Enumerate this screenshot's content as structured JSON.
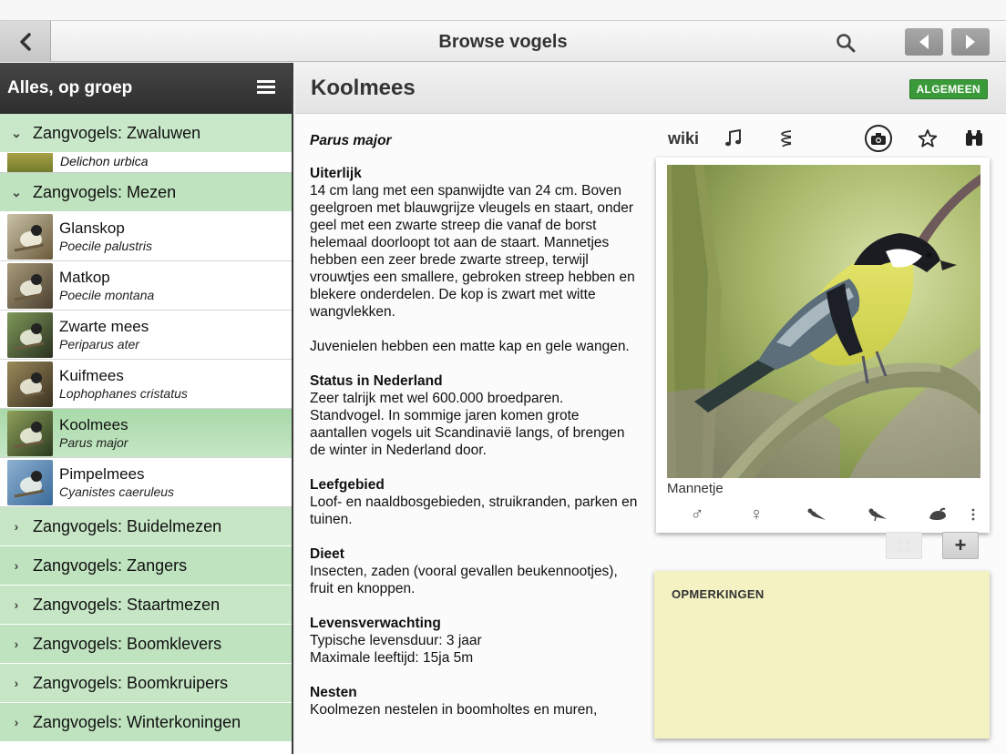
{
  "topbar": {
    "title": "Browse vogels",
    "icons": [
      "back-arrow-icon",
      "search-icon",
      "previous-arrow-icon",
      "next-arrow-icon"
    ]
  },
  "sidebar": {
    "title": "Alles, op groep",
    "groups_top": [
      {
        "label": "Zangvogels: Zwaluwen",
        "partial_item": {
          "scientific": "Delichon urbica"
        }
      },
      {
        "label": "Zangvogels: Mezen"
      }
    ],
    "birds": [
      {
        "name": "Glanskop",
        "scientific": "Poecile palustris"
      },
      {
        "name": "Matkop",
        "scientific": "Poecile montana"
      },
      {
        "name": "Zwarte mees",
        "scientific": "Periparus ater"
      },
      {
        "name": "Kuifmees",
        "scientific": "Lophophanes cristatus"
      },
      {
        "name": "Koolmees",
        "scientific": "Parus major",
        "selected": true
      },
      {
        "name": "Pimpelmees",
        "scientific": "Cyanistes caeruleus"
      }
    ],
    "groups": [
      {
        "label": "Zangvogels: Buidelmezen"
      },
      {
        "label": "Zangvogels: Zangers"
      },
      {
        "label": "Zangvogels: Staartmezen"
      },
      {
        "label": "Zangvogels: Boomklevers"
      },
      {
        "label": "Zangvogels: Boomkruipers"
      },
      {
        "label": "Zangvogels: Winterkoningen"
      }
    ]
  },
  "main": {
    "title": "Koolmees",
    "badge": "ALGEMEEN",
    "latin": "Parus major",
    "sections": [
      {
        "heading": "Uiterlijk",
        "text": "14 cm lang met een spanwijdte van 24 cm. Boven geelgroen met blauwgrijze vleugels en staart, onder geel met een zwarte streep die vanaf de borst helemaal doorloopt tot aan de staart. Mannetjes hebben een zeer brede zwarte streep, terwijl vrouwtjes een smallere, gebroken streep hebben en blekere onderdelen. De kop is zwart met witte wangvlekken."
      },
      {
        "heading": "",
        "text": "Juvenielen hebben een matte kap en gele wangen."
      },
      {
        "heading": "Status in Nederland",
        "text": "Zeer talrijk met wel 600.000 broedparen. Standvogel. In sommige jaren komen grote aantallen vogels uit Scandinavië langs, of brengen de winter in Nederland door."
      },
      {
        "heading": "Leefgebied",
        "text": "Loof- en naaldbosgebieden, struikranden, parken en tuinen."
      },
      {
        "heading": "Dieet",
        "text": "Insecten, zaden (vooral gevallen beukennootjes), fruit en knoppen."
      },
      {
        "heading": "Levensverwachting",
        "text": "Typische levensduur: 3 jaar\nMaximale leeftijd: 15ja 5m"
      },
      {
        "heading": "Nesten",
        "text": "Koolmezen nestelen in boomholtes en muren,"
      }
    ],
    "toolbar": {
      "wiki_label": "wiki",
      "icons": [
        "music-note-icon",
        "sonogram-icon",
        "camera-icon",
        "star-icon",
        "binoculars-icon"
      ]
    },
    "photo": {
      "caption": "Mannetje",
      "icons": [
        "male-symbol-icon",
        "female-symbol-icon",
        "bird-perched-icon",
        "bird-side-icon",
        "bird-egg-icon",
        "more-vertical-icon"
      ]
    },
    "buttons": {
      "plus": "+"
    },
    "notes": {
      "title": "OPMERKINGEN"
    }
  }
}
